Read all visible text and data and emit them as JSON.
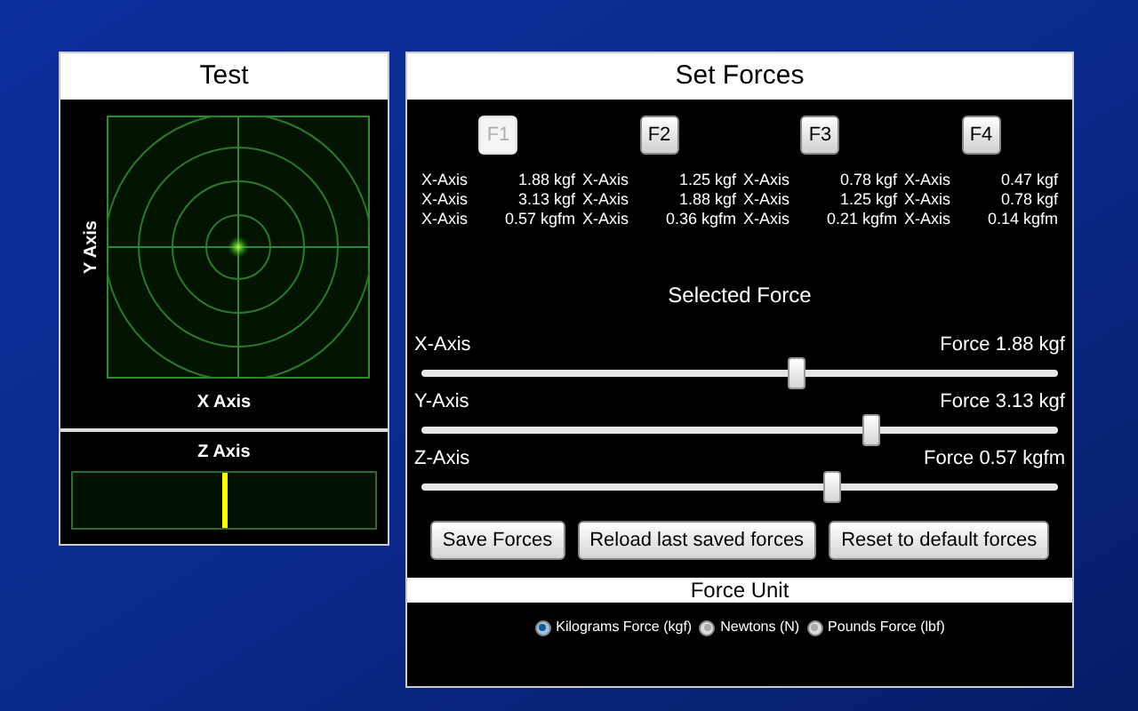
{
  "test_panel": {
    "title": "Test",
    "target": {
      "y_label": "Y Axis",
      "x_label": "X Axis"
    },
    "z_axis": {
      "label": "Z Axis",
      "level": 0.5
    }
  },
  "set_forces": {
    "title": "Set Forces",
    "presets": [
      {
        "label": "F1",
        "selected": true,
        "rows": [
          [
            "X-Axis",
            "1.88 kgf"
          ],
          [
            "X-Axis",
            "3.13 kgf"
          ],
          [
            "X-Axis",
            "0.57 kgfm"
          ]
        ]
      },
      {
        "label": "F2",
        "selected": false,
        "rows": [
          [
            "X-Axis",
            "1.25 kgf"
          ],
          [
            "X-Axis",
            "1.88 kgf"
          ],
          [
            "X-Axis",
            "0.36 kgfm"
          ]
        ]
      },
      {
        "label": "F3",
        "selected": false,
        "rows": [
          [
            "X-Axis",
            "0.78 kgf"
          ],
          [
            "X-Axis",
            "1.25 kgf"
          ],
          [
            "X-Axis",
            "0.21 kgfm"
          ]
        ]
      },
      {
        "label": "F4",
        "selected": false,
        "rows": [
          [
            "X-Axis",
            "0.47 kgf"
          ],
          [
            "X-Axis",
            "0.78 kgf"
          ],
          [
            "X-Axis",
            "0.14 kgfm"
          ]
        ]
      }
    ],
    "selected_force_heading": "Selected Force",
    "sliders": [
      {
        "label": "X-Axis",
        "reading": "Force 1.88 kgf",
        "level": 0.59
      },
      {
        "label": "Y-Axis",
        "reading": "Force 3.13 kgf",
        "level": 0.706
      },
      {
        "label": "Z-Axis",
        "reading": "Force 0.57 kgfm",
        "level": 0.644
      }
    ],
    "buttons": [
      "Save Forces",
      "Reload last saved forces",
      "Reset to default forces"
    ],
    "force_unit": {
      "title": "Force Unit",
      "options": [
        {
          "label": "Kilograms Force (kgf)",
          "selected": true
        },
        {
          "label": "Newtons (N)",
          "selected": false
        },
        {
          "label": "Pounds Force (lbf)",
          "selected": false
        }
      ]
    }
  }
}
